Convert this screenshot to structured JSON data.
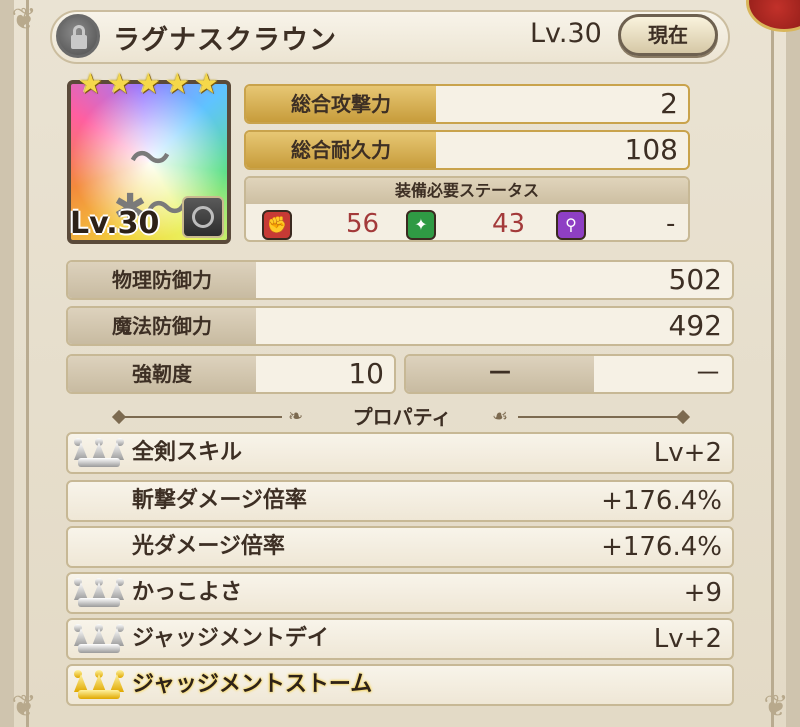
{
  "header": {
    "title": "ラグナスクラウン",
    "level": "Lv.30",
    "current_button": "現在"
  },
  "item": {
    "stars": 5,
    "level_badge": "Lv.30",
    "emblem_icon": "winged-emblem-icon",
    "type_icon": "armor-type-icon"
  },
  "stats_top": [
    {
      "label": "総合攻撃力",
      "value": "2"
    },
    {
      "label": "総合耐久力",
      "value": "108"
    }
  ],
  "requirements": {
    "title": "装備必要ステータス",
    "items": [
      {
        "icon": "fist-icon",
        "color": "#c73a35",
        "value": "56"
      },
      {
        "icon": "sparkle-icon",
        "color": "#2f9a44",
        "value": "43"
      },
      {
        "icon": "wand-icon",
        "color": "#8e3fc4",
        "value": "-"
      }
    ]
  },
  "stats": [
    {
      "label": "物理防御力",
      "value": "502"
    },
    {
      "label": "魔法防御力",
      "value": "492"
    }
  ],
  "toughness": {
    "label": "強靭度",
    "value": "10",
    "label2": "－",
    "value2": "－"
  },
  "properties": {
    "title": "プロパティ",
    "rows": [
      {
        "crown": "silver",
        "name": "全剣スキル",
        "value": "Lv+2"
      },
      {
        "crown": "none",
        "name": "斬撃ダメージ倍率",
        "value": "+176.4%"
      },
      {
        "crown": "none",
        "name": "光ダメージ倍率",
        "value": "+176.4%"
      },
      {
        "crown": "silver",
        "name": "かっこよさ",
        "value": "+9"
      },
      {
        "crown": "silver",
        "name": "ジャッジメントデイ",
        "value": "Lv+2"
      },
      {
        "crown": "gold",
        "name": "ジャッジメントストーム",
        "value": ""
      }
    ]
  }
}
